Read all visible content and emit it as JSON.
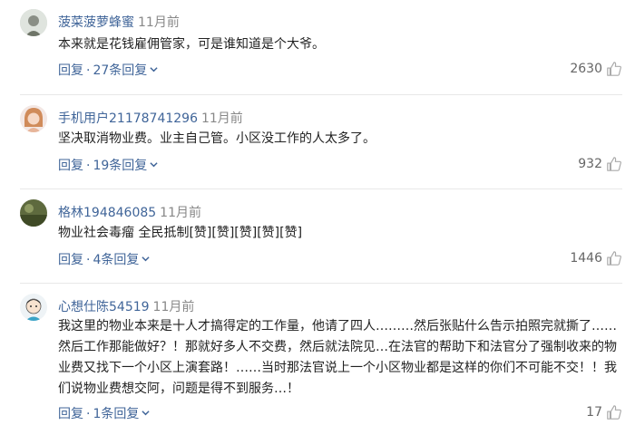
{
  "reply_label": "回复",
  "sep": "·",
  "comments": [
    {
      "username": "菠菜菠萝蜂蜜",
      "time": "11月前",
      "text": "本来就是花钱雇佣管家，可是谁知道是个大爷。",
      "replies": "27条回复",
      "likes": "2630",
      "avatar": "avatar-image"
    },
    {
      "username": "手机用户21178741296",
      "time": "11月前",
      "text": "坚决取消物业费。业主自己管。小区没工作的人太多了。",
      "replies": "19条回复",
      "likes": "932",
      "avatar": "avatar-image"
    },
    {
      "username": "格林194846085",
      "time": "11月前",
      "text": "物业社会毒瘤 全民抵制[赞][赞][赞][赞][赞]",
      "replies": "4条回复",
      "likes": "1446",
      "avatar": "avatar-image"
    },
    {
      "username": "心想仕陈54519",
      "time": "11月前",
      "text": "我这里的物业本来是十人才搞得定的工作量，他请了四人………然后张贴什么告示拍照完就撕了……然后工作那能做好？！那就好多人不交费，然后就法院见…在法官的帮助下和法官分了强制收来的物业费又找下一个小区上演套路！……当时那法官说上一个小区物业都是这样的你们不可能不交！！我们说物业费想交阿，问题是得不到服务…！",
      "replies": "1条回复",
      "likes": "17",
      "avatar": "avatar-image"
    }
  ],
  "colors": {
    "username": "#406599",
    "link": "#406599",
    "meta": "#888888",
    "divider": "#e8e8e8"
  },
  "icons": [
    "thumbs-up-icon",
    "chevron-down-icon"
  ]
}
